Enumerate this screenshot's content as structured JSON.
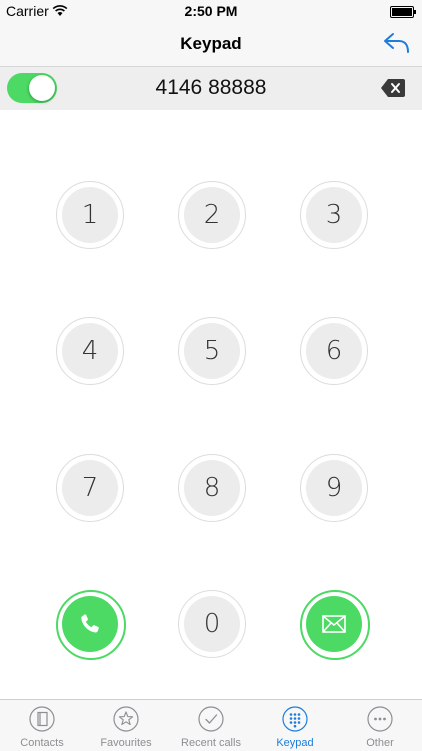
{
  "status_bar": {
    "carrier": "Carrier",
    "time": "2:50 PM"
  },
  "nav": {
    "title": "Keypad"
  },
  "dialer": {
    "number": "4146 88888",
    "toggle_on": true
  },
  "keys": [
    "1",
    "2",
    "3",
    "4",
    "5",
    "6",
    "7",
    "8",
    "9",
    "0"
  ],
  "tabs": [
    {
      "label": "Contacts",
      "icon": "contacts-icon"
    },
    {
      "label": "Favourites",
      "icon": "star-icon"
    },
    {
      "label": "Recent calls",
      "icon": "checkmark-icon"
    },
    {
      "label": "Keypad",
      "icon": "keypad-icon",
      "active": true
    },
    {
      "label": "Other",
      "icon": "more-icon"
    }
  ],
  "colors": {
    "accent": "#1d7ddb",
    "green": "#4cd964"
  }
}
